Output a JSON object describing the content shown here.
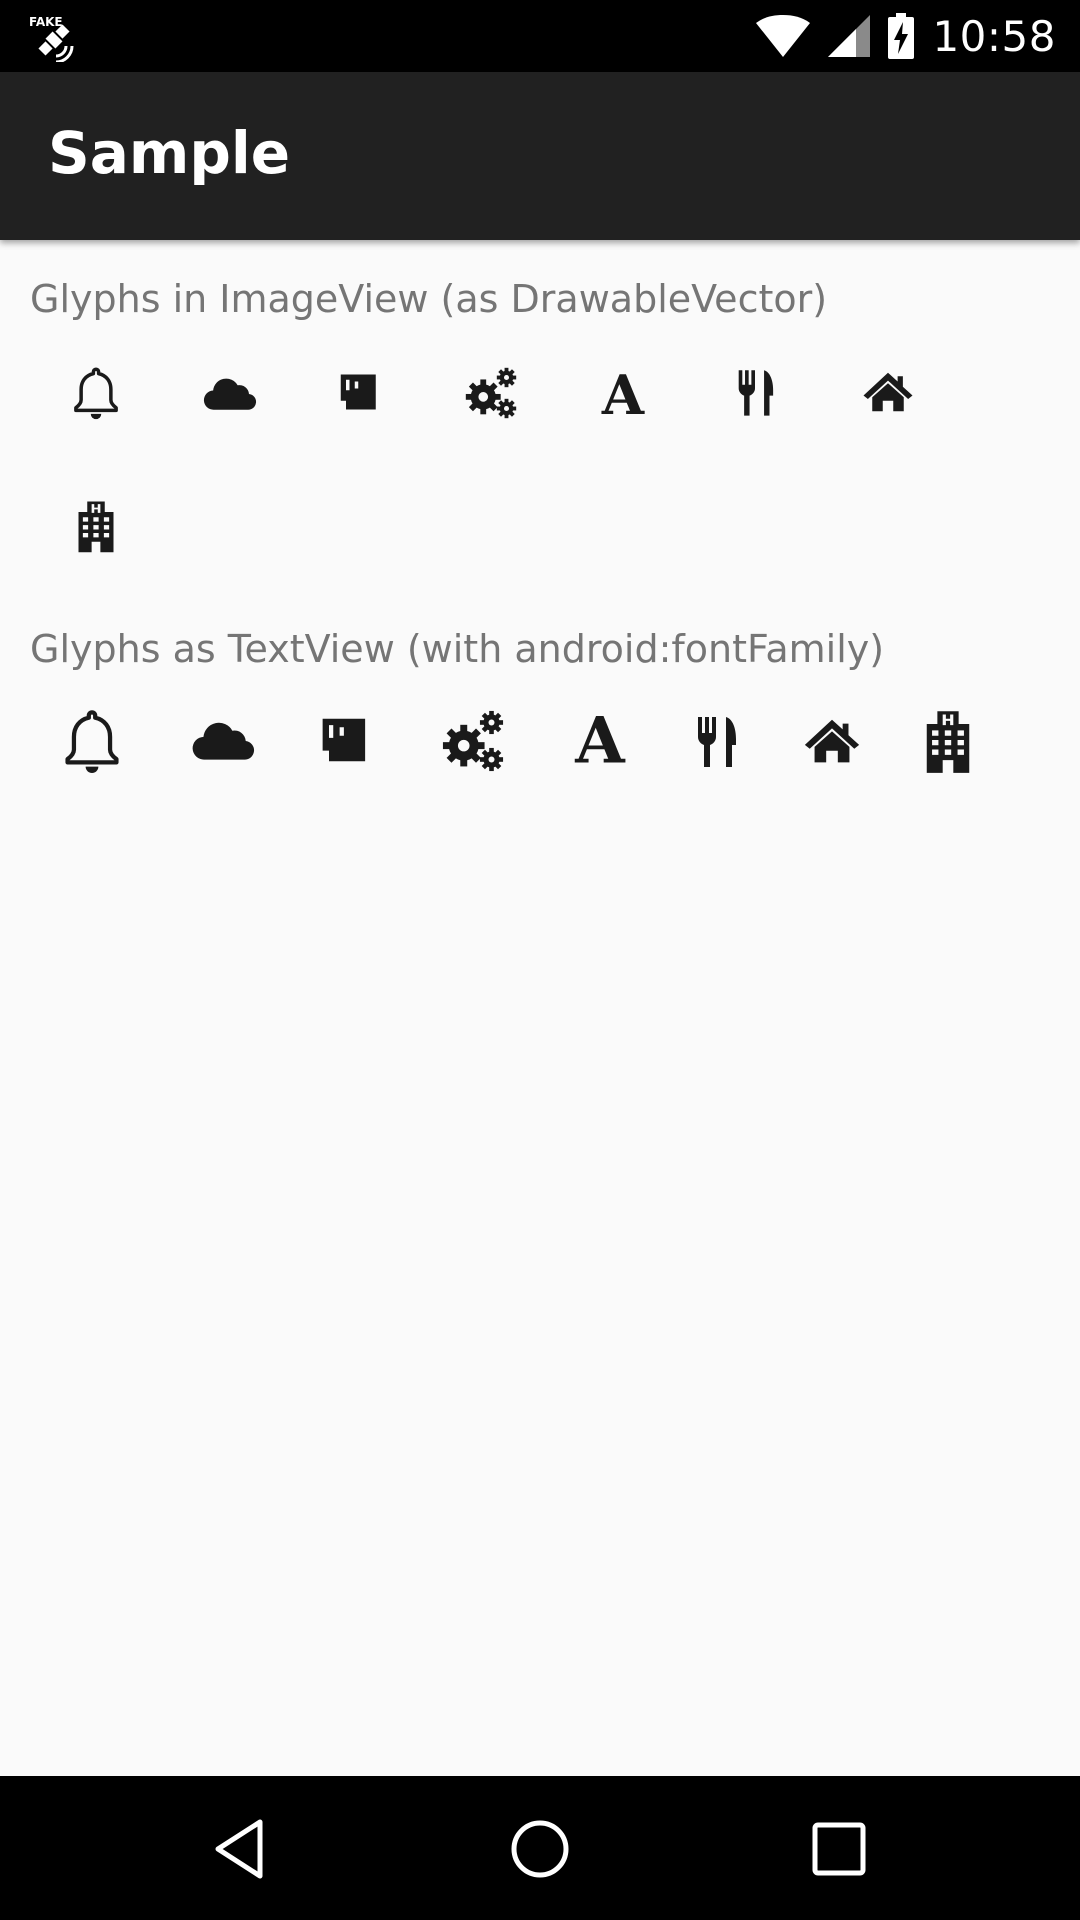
{
  "status_bar": {
    "time": "10:58",
    "left_icon": "fake-gps-satellite-icon",
    "icons": [
      "wifi-icon",
      "cell-signal-icon",
      "battery-charging-icon"
    ]
  },
  "app_bar": {
    "title": "Sample"
  },
  "section_image_view": {
    "label": "Glyphs in ImageView (as DrawableVector)",
    "glyphs": [
      "bell-icon",
      "cloud-icon",
      "tablet-icon",
      "gears-icon",
      "letter-a-icon",
      "restaurant-icon",
      "home-icon",
      "hospital-icon"
    ]
  },
  "section_text_view": {
    "label": "Glyphs as TextView (with android:fontFamily)",
    "glyphs": [
      "bell-icon",
      "cloud-icon",
      "tablet-icon",
      "gears-icon",
      "letter-a-icon",
      "restaurant-icon",
      "home-icon",
      "hospital-icon"
    ]
  },
  "nav_bar": {
    "buttons": [
      "back-icon",
      "home-circle-icon",
      "recents-icon"
    ]
  },
  "colors": {
    "status_bar": "#000000",
    "app_bar": "#212121",
    "background": "#fafafa",
    "label_text": "#757575",
    "glyph": "#1a1a1a"
  }
}
